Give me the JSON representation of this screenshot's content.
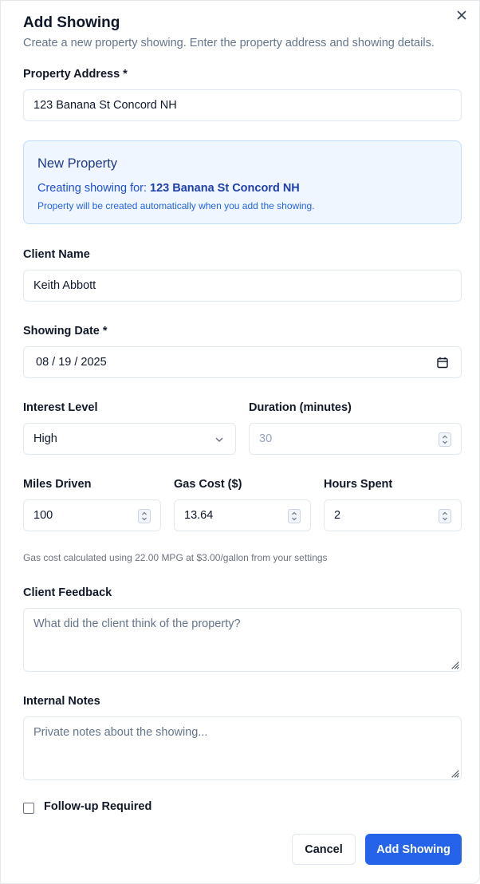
{
  "dialog": {
    "title": "Add Showing",
    "subtitle": "Create a new property showing. Enter the property address and showing details.",
    "close_icon": "close-icon"
  },
  "property_address": {
    "label": "Property Address *",
    "value": "123 Banana St Concord NH"
  },
  "new_property": {
    "title": "New Property",
    "creating_prefix": "Creating showing for:",
    "address": "123 Banana St Concord NH",
    "note": "Property will be created automatically when you add the showing."
  },
  "client_name": {
    "label": "Client Name",
    "value": "Keith Abbott"
  },
  "showing_date": {
    "label": "Showing Date *",
    "value": "08 / 19 / 2025",
    "icon": "calendar-icon"
  },
  "interest_level": {
    "label": "Interest Level",
    "value": "High",
    "icon": "chevron-down-icon"
  },
  "duration": {
    "label": "Duration (minutes)",
    "placeholder": "30"
  },
  "miles_driven": {
    "label": "Miles Driven",
    "value": "100"
  },
  "gas_cost": {
    "label": "Gas Cost ($)",
    "value": "13.64"
  },
  "hours_spent": {
    "label": "Hours Spent",
    "value": "2"
  },
  "gas_helper": "Gas cost calculated using 22.00 MPG at $3.00/gallon from your settings",
  "client_feedback": {
    "label": "Client Feedback",
    "placeholder": "What did the client think of the property?"
  },
  "internal_notes": {
    "label": "Internal Notes",
    "placeholder": "Private notes about the showing..."
  },
  "follow_up": {
    "label": "Follow-up Required",
    "checked": false
  },
  "actions": {
    "cancel_label": "Cancel",
    "submit_label": "Add Showing"
  },
  "colors": {
    "primary": "#2563eb",
    "info_background": "#eff6ff",
    "info_border": "#bfdbfe"
  }
}
